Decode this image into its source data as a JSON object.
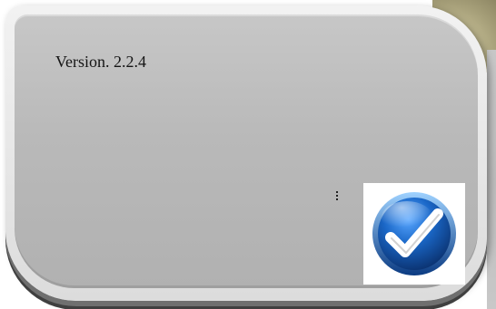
{
  "dialog": {
    "version_text": "Version. 2.2.4"
  },
  "icons": {
    "ok": "checkmark-icon"
  },
  "colors": {
    "panel_grey": "#b9b9b9",
    "button_blue": "#1a67c7",
    "button_ring": "#0b3b82",
    "check_white": "#ffffff"
  }
}
